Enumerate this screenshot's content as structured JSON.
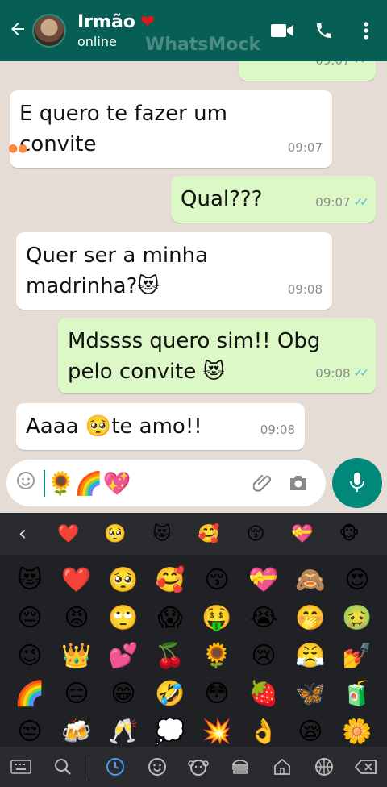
{
  "header": {
    "name": "Irmão",
    "status": "online",
    "watermark": "WhatsMock"
  },
  "messages": [
    {
      "text_line1": "E quero te fazer um",
      "text_line2": "convite",
      "time": "09:07",
      "dir": "in"
    },
    {
      "text": "Qual???",
      "time": "09:07",
      "dir": "out"
    },
    {
      "text_line1": "Quer ser a minha",
      "text_line2": "madrinha?😻",
      "time": "09:08",
      "dir": "in"
    },
    {
      "text_line1": "Mdssss quero sim!! Obg",
      "text_line2": "pelo convite 😻",
      "time": "09:08",
      "dir": "out"
    },
    {
      "text": "Aaaa 🥺te amo!!",
      "time": "09:08",
      "dir": "in"
    }
  ],
  "partial_top_time": "09:07",
  "composer": {
    "text": "🌻🌈💖"
  },
  "keyboard": {
    "recent": [
      "❤️",
      "🥺",
      "😻",
      "🥰",
      "😚",
      "💝",
      "🐵"
    ],
    "grid": [
      "😻",
      "❤️",
      "🥺",
      "🥰",
      "😚",
      "💝",
      "🙈",
      "😍",
      "😔",
      "😡",
      "🙄",
      "😱",
      "🤑",
      "😭",
      "🤭",
      "🤢",
      "😉",
      "👑",
      "💕",
      "🍒",
      "🌻",
      "😢",
      "😤",
      "💅",
      "🌈",
      "😑",
      "😁",
      "🤣",
      "😳",
      "🍓",
      "🦋",
      "🧃",
      "😒",
      "🍻",
      "🥂",
      "💭",
      "💥",
      "👌",
      "😪",
      "🌼"
    ]
  },
  "colors": {
    "header": "#075e54",
    "incoming": "#ffffff",
    "outgoing": "#dcf8c6",
    "read_ticks": "#4fb6ec",
    "mic": "#00897b",
    "keyboard_bg": "#202124"
  },
  "icons": {
    "back": "back-arrow-icon",
    "video": "video-call-icon",
    "phone": "phone-call-icon",
    "menu": "more-vert-icon",
    "emoji": "emoji-icon",
    "attach": "paperclip-icon",
    "camera": "camera-icon",
    "mic": "microphone-icon"
  }
}
